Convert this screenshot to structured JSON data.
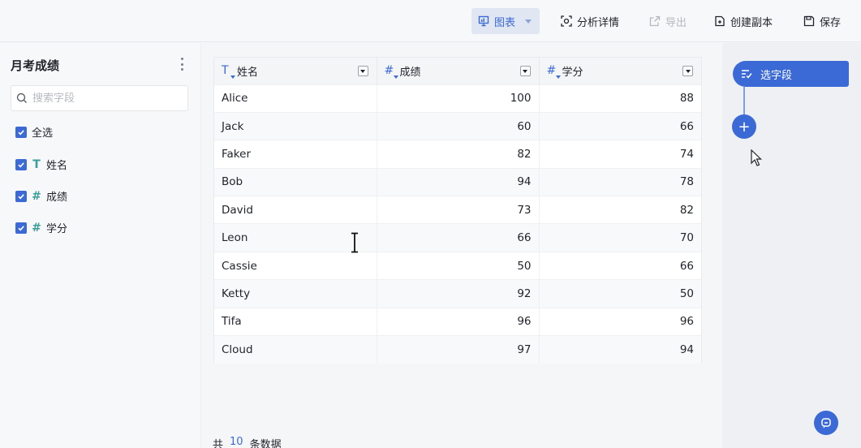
{
  "toolbar": {
    "chart_label": "图表",
    "analysis_label": "分析详情",
    "export_label": "导出",
    "copy_label": "创建副本",
    "save_label": "保存"
  },
  "sidebar": {
    "title": "月考成绩",
    "search_placeholder": "搜索字段",
    "select_all": "全选",
    "fields": [
      {
        "type_icon": "T",
        "name": "姓名"
      },
      {
        "type_icon": "#",
        "name": "成绩"
      },
      {
        "type_icon": "#",
        "name": "学分"
      }
    ]
  },
  "table": {
    "columns": [
      "姓名",
      "成绩",
      "学分"
    ],
    "rows": [
      {
        "name": "Alice",
        "score": "100",
        "credit": "88"
      },
      {
        "name": "Jack",
        "score": "60",
        "credit": "66"
      },
      {
        "name": "Faker",
        "score": "82",
        "credit": "74"
      },
      {
        "name": "Bob",
        "score": "94",
        "credit": "78"
      },
      {
        "name": "David",
        "score": "73",
        "credit": "82"
      },
      {
        "name": "Leon",
        "score": "66",
        "credit": "70"
      },
      {
        "name": "Cassie",
        "score": "50",
        "credit": "66"
      },
      {
        "name": "Ketty",
        "score": "92",
        "credit": "50"
      },
      {
        "name": "Tifa",
        "score": "96",
        "credit": "96"
      },
      {
        "name": "Cloud",
        "score": "97",
        "credit": "94"
      }
    ]
  },
  "footer": {
    "prefix": "共",
    "count": "10",
    "suffix": "条数据"
  },
  "flow": {
    "select_field_label": "选字段",
    "add_symbol": "+"
  },
  "colors": {
    "accent": "#3b6ad6",
    "field_type": "#3c9e9b"
  }
}
